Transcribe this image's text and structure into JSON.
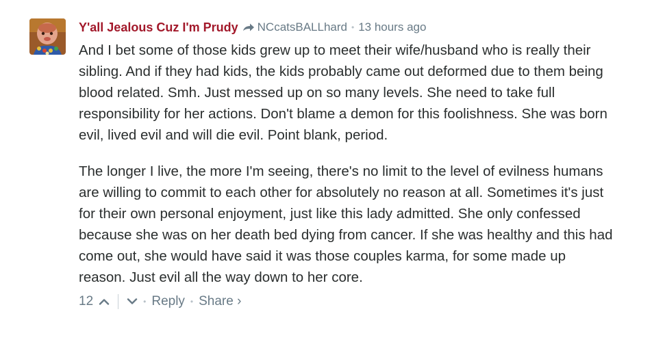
{
  "comment": {
    "author": "Y'all Jealous Cuz I'm Prudy",
    "reply_to": "NCcatsBALLhard",
    "separator": "•",
    "timestamp": "13 hours ago",
    "paragraphs": [
      "And I bet some of those kids grew up to meet their wife/husband who is really their sibling. And if they had kids, the kids probably came out deformed due to them being blood related. Smh. Just messed up on so many levels. She need to take full responsibility for her actions. Don't blame a demon for this foolishness. She was born evil, lived evil and will die evil. Point blank, period.",
      "The longer I live, the more I'm seeing, there's no limit to the level of evilness humans are willing to commit to each other for absolutely no reason at all. Sometimes it's just for their own personal enjoyment, just like this lady admitted. She only confessed because she was on her death bed dying from cancer. If she was healthy and this had come out, she would have said it was those couples karma, for some made up reason. Just evil all the way down to her core."
    ],
    "footer": {
      "upvotes": "12",
      "reply_label": "Reply",
      "share_label": "Share ›"
    }
  },
  "colors": {
    "author": "#a2182a",
    "meta": "#687a86",
    "text": "#2a2e2e"
  },
  "icons": {
    "reply_arrow": "reply-arrow-icon",
    "upvote": "chevron-up-icon",
    "downvote": "chevron-down-icon"
  }
}
